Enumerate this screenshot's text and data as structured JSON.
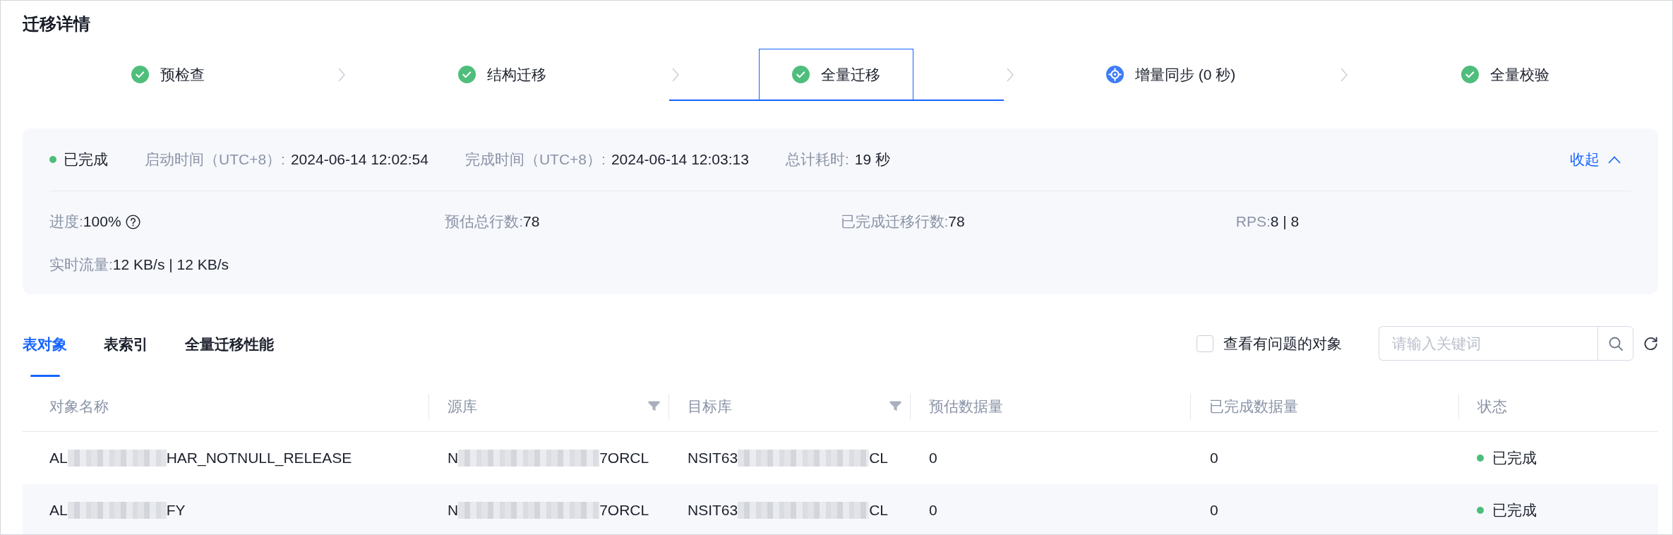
{
  "title": "迁移详情",
  "steps": [
    {
      "label": "预检查",
      "kind": "done",
      "selected": false
    },
    {
      "label": "结构迁移",
      "kind": "done",
      "selected": false
    },
    {
      "label": "全量迁移",
      "kind": "done",
      "selected": true
    },
    {
      "label": "增量同步 (0 秒)",
      "kind": "running",
      "selected": false
    },
    {
      "label": "全量校验",
      "kind": "done",
      "selected": false
    }
  ],
  "summary": {
    "status": {
      "text": "已完成",
      "color": "#4cbd7b"
    },
    "times": [
      {
        "label": "启动时间（UTC+8）:",
        "value": "2024-06-14 12:02:54"
      },
      {
        "label": "完成时间（UTC+8）:",
        "value": "2024-06-14 12:03:13"
      },
      {
        "label": "总计耗时:",
        "value": "19 秒"
      }
    ],
    "collapse_link": "收起",
    "metrics": [
      {
        "label": "进度:",
        "value": "100%",
        "help": true
      },
      {
        "label": "预估总行数:",
        "value": "78"
      },
      {
        "label": "已完成迁移行数:",
        "value": "78"
      },
      {
        "label": "RPS:",
        "value": "8 | 8"
      },
      {
        "label": "实时流量:",
        "value": "12 KB/s | 12 KB/s"
      }
    ]
  },
  "tabs": [
    {
      "label": "表对象",
      "selected": true
    },
    {
      "label": "表索引",
      "selected": false
    },
    {
      "label": "全量迁移性能",
      "selected": false
    }
  ],
  "issue_filter": {
    "label": "查看有问题的对象",
    "checked": false
  },
  "search": {
    "placeholder": "请输入关键词"
  },
  "table": {
    "columns": [
      {
        "label": "对象名称",
        "filter": false
      },
      {
        "label": "源库",
        "filter": true
      },
      {
        "label": "目标库",
        "filter": true
      },
      {
        "label": "预估数据量",
        "filter": false
      },
      {
        "label": "已完成数据量",
        "filter": false
      },
      {
        "label": "状态",
        "filter": false
      }
    ],
    "rows": [
      {
        "object_name": {
          "text_start": "AL",
          "text_end": "HAR_NOTNULL_RELEASE"
        },
        "source_db": {
          "text_start": "N",
          "text_end": "7ORCL"
        },
        "target_db": {
          "text_start": "NSIT63",
          "text_end": "CL"
        },
        "estimated_size": "0",
        "completed_size": "0",
        "status": {
          "text": "已完成",
          "color": "#4cbd7b"
        }
      },
      {
        "object_name": {
          "text_start": "AL",
          "text_end": "FY"
        },
        "source_db": {
          "text_start": "N",
          "text_end": "7ORCL"
        },
        "target_db": {
          "text_start": "NSIT63",
          "text_end": "CL"
        },
        "estimated_size": "0",
        "completed_size": "0",
        "status": {
          "text": "已完成",
          "color": "#4cbd7b"
        }
      }
    ]
  }
}
